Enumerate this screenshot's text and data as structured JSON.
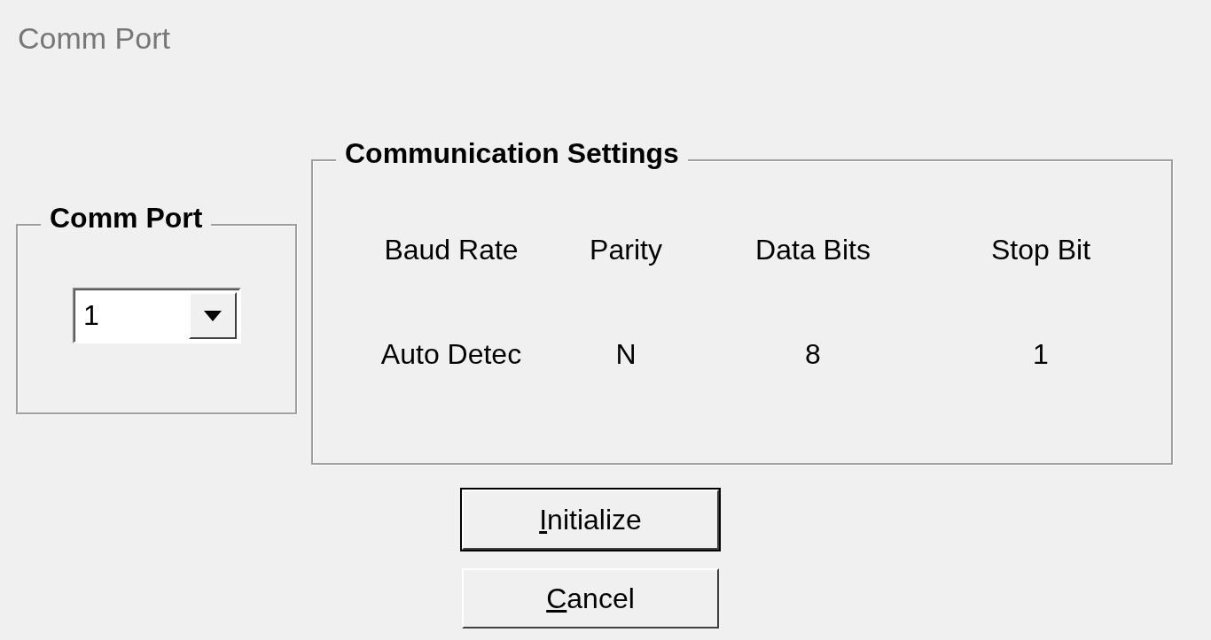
{
  "window": {
    "title": "Comm Port"
  },
  "comm_port": {
    "title": "Comm Port",
    "value": "1"
  },
  "communication_settings": {
    "title": "Communication Settings",
    "columns": [
      {
        "header": "Baud Rate",
        "value": "Auto Detec"
      },
      {
        "header": "Parity",
        "value": "N"
      },
      {
        "header": "Data Bits",
        "value": "8"
      },
      {
        "header": "Stop Bit",
        "value": "1"
      }
    ]
  },
  "buttons": [
    {
      "label": "Initialize",
      "kind": "default"
    },
    {
      "label": "Cancel",
      "kind": "normal"
    }
  ]
}
